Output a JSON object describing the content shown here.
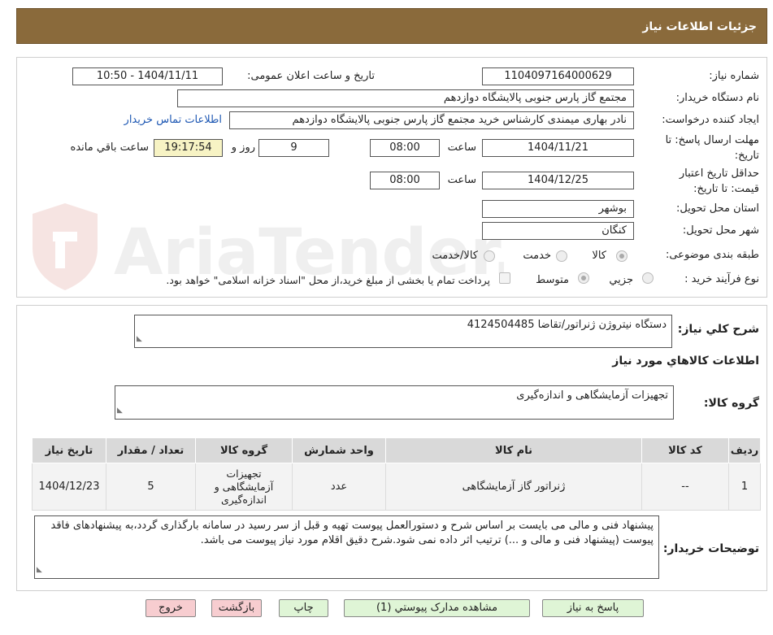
{
  "header": {
    "title": "جزئیات اطلاعات نیاز"
  },
  "watermark": {
    "text": "AriaTender.neT"
  },
  "form": {
    "need_number_label": "شماره نیاز:",
    "need_number": "1104097164000629",
    "announce_label": "تاریخ و ساعت اعلان عمومی:",
    "announce_value": "1404/11/11 - 10:50",
    "buyer_label": "نام دستگاه خریدار:",
    "buyer_value": "مجتمع گاز پارس جنوبی  پالایشگاه دوازدهم",
    "creator_label": "ایجاد کننده درخواست:",
    "creator_value": "نادر بهاری میمندی کارشناس خرید مجتمع گاز پارس جنوبی  پالایشگاه دوازدهم",
    "contact_link": "اطلاعات تماس خریدار",
    "deadline_label_1": "مهلت ارسال پاسخ: تا",
    "deadline_label_2": "تاریخ:",
    "deadline_date": "1404/11/21",
    "time_label": "ساعت",
    "deadline_time": "08:00",
    "days_value": "9",
    "days_label": "روز و",
    "remaining_time": "19:17:54",
    "remaining_label": "ساعت باقي مانده",
    "validity_label_1": "حداقل تاريخ اعتبار",
    "validity_label_2": "قيمت: تا تاريخ:",
    "validity_date": "1404/12/25",
    "validity_time": "08:00",
    "province_label": "استان محل تحویل:",
    "province_value": "بوشهر",
    "city_label": "شهر محل تحویل:",
    "city_value": "کنگان",
    "category_label": "طبقه بندی موضوعی:",
    "category_options": [
      "کالا",
      "خدمت",
      "کالا/خدمت"
    ],
    "process_label": "نوع فرآیند خرید :",
    "process_options": [
      "جزيي",
      "متوسط"
    ],
    "payment_note": "پرداخت تمام یا بخشی از مبلغ خرید،از محل \"اسناد خزانه اسلامی\" خواهد بود."
  },
  "summary": {
    "label": "شرح کلي نياز:",
    "value": "دستگاه نیتروژن ژنراتور/تقاضا 4124504485",
    "goods_title": "اطلاعات کالاهاي مورد نياز",
    "group_label": "گروه کالا:",
    "group_value": "تجهیزات آزمایشگاهی و اندازه‌گیری"
  },
  "table": {
    "headers": [
      "رديف",
      "کد کالا",
      "نام کالا",
      "واحد شمارش",
      "گروه کالا",
      "تعداد / مقدار",
      "تاريخ نياز"
    ],
    "rows": [
      [
        "1",
        "--",
        "ژنراتور گاز آزمایشگاهی",
        "عدد",
        "تجهیزات آزمایشگاهی و اندازه‌گیری",
        "5",
        "1404/12/23"
      ]
    ]
  },
  "buyer_notes": {
    "label": "توضیحات خریدار:",
    "value": "پیشنهاد فنی و مالی می بایست بر اساس شرح و دستورالعمل پیوست تهیه و قبل از سر رسید در سامانه بارگذاری گردد،به پیشنهادهای فاقد پیوست (پیشنهاد فنی و مالی و ...) ترتیب اثر داده نمی شود.شرح دقیق اقلام مورد نیاز پیوست می باشد."
  },
  "buttons": {
    "reply": "پاسخ به نیاز",
    "attachments": "مشاهده مدارک پیوستي (1)",
    "print": "چاپ",
    "back": "بازگشت",
    "exit": "خروج"
  }
}
